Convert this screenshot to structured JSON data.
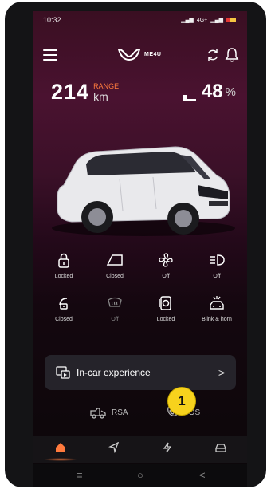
{
  "status_bar": {
    "time": "10:32",
    "signal_text": "4G+"
  },
  "brand": {
    "logo_text": "ME4U"
  },
  "range": {
    "value": "214",
    "label": "RANGE",
    "unit": "km"
  },
  "battery": {
    "value": "48",
    "unit": "%"
  },
  "controls": [
    {
      "label": "Locked",
      "icon": "lock-icon"
    },
    {
      "label": "Closed",
      "icon": "window-icon"
    },
    {
      "label": "Off",
      "icon": "fan-icon"
    },
    {
      "label": "Off",
      "icon": "headlight-icon"
    },
    {
      "label": "Closed",
      "icon": "fuel-flap-icon"
    },
    {
      "label": "Off",
      "icon": "defogger-icon"
    },
    {
      "label": "Locked",
      "icon": "charge-lid-icon"
    },
    {
      "label": "Blink & horn",
      "icon": "blink-horn-icon"
    }
  ],
  "card": {
    "title": "In-car experience",
    "chevron": ">"
  },
  "actions": {
    "rsa": "RSA",
    "sos": "SOS"
  },
  "badge": {
    "number": "1"
  },
  "colors": {
    "accent": "#ff7a3d",
    "badge": "#f7d21d"
  }
}
